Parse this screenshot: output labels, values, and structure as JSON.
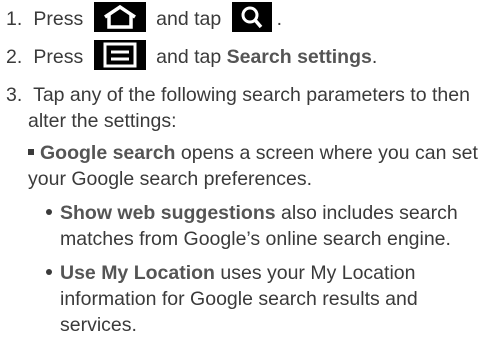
{
  "steps": [
    {
      "num": "1.",
      "before": "Press",
      "between": "and tap",
      "after": ".",
      "icon1": "home-icon",
      "icon2": "search-icon"
    },
    {
      "num": "2.",
      "before": "Press",
      "between": "and tap",
      "bold": "Search settings",
      "after": ".",
      "icon1": "menu-icon"
    },
    {
      "num": "3.",
      "line1": "Tap any of the following search parameters to then",
      "line2": "alter the settings:"
    }
  ],
  "sub": {
    "bold": "Google search",
    "line1": "opens a screen where you can set",
    "line2": "your Google search preferences."
  },
  "bullets": [
    {
      "bold": "Show web suggestions",
      "line1": "also includes search",
      "line2": "matches from Google’s online search engine."
    },
    {
      "bold": "Use My Location",
      "line1": "uses your My Location",
      "line2": "information for Google search results and",
      "line3": "services."
    }
  ],
  "colors": {
    "text": "#3a3a3a",
    "icon_bg": "#000000",
    "icon_fg": "#ffffff"
  }
}
